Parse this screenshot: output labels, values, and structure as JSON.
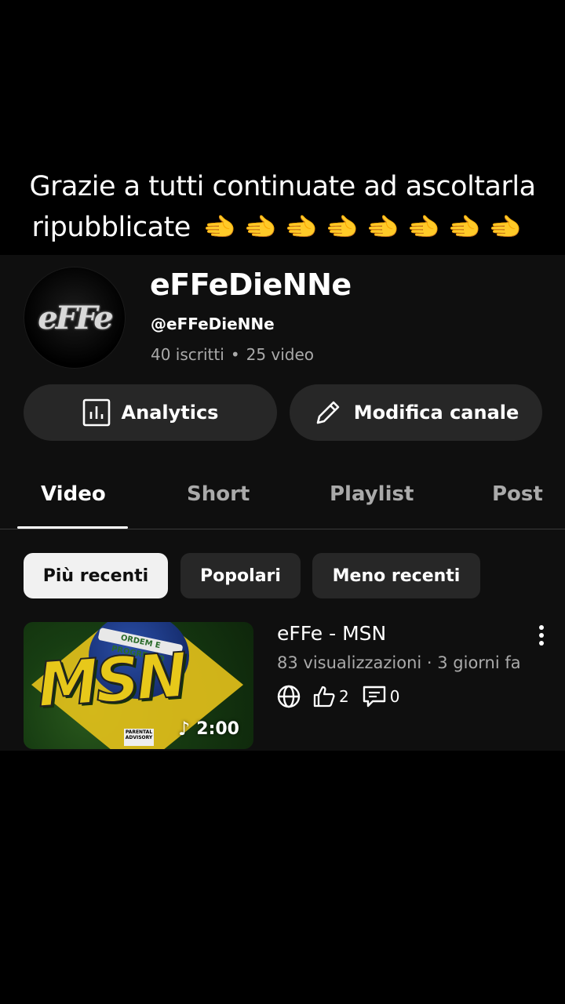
{
  "overlay": {
    "line1": "Grazie a tutti continuate ad ascoltarla",
    "line2": "ripubblicate",
    "emojis": [
      "🫲",
      "🫲",
      "🫲",
      "🫲",
      "🫲",
      "🫲",
      "🫲",
      "🫲"
    ]
  },
  "channel": {
    "avatar_text": "eFFe",
    "name": "eFFeDieNNe",
    "handle": "@eFFeDieNNe",
    "subscribers": "40 iscritti",
    "videos": "25 video",
    "separator": "•"
  },
  "actions": {
    "analytics_label": "Analytics",
    "edit_label": "Modifica canale"
  },
  "tabs": [
    {
      "label": "Video",
      "active": true
    },
    {
      "label": "Short",
      "active": false
    },
    {
      "label": "Playlist",
      "active": false
    },
    {
      "label": "Post",
      "active": false
    }
  ],
  "filters": [
    {
      "label": "Più recenti",
      "selected": true
    },
    {
      "label": "Popolari",
      "selected": false
    },
    {
      "label": "Meno recenti",
      "selected": false
    }
  ],
  "video": {
    "title": "eFFe - MSN",
    "meta": "83 visualizzazioni · 3 giorni fa",
    "duration": "2:00",
    "likes": "2",
    "comments": "0",
    "thumb_text": "MSN",
    "thumb_banner": "ORDEM E PROGRESSO",
    "thumb_advisory": "PARENTAL ADVISORY"
  },
  "colors": {
    "background": "#000000",
    "panel": "#0f0f0f",
    "button": "#272727",
    "chip_selected": "#f1f1f1",
    "muted_text": "#aaaaaa"
  }
}
